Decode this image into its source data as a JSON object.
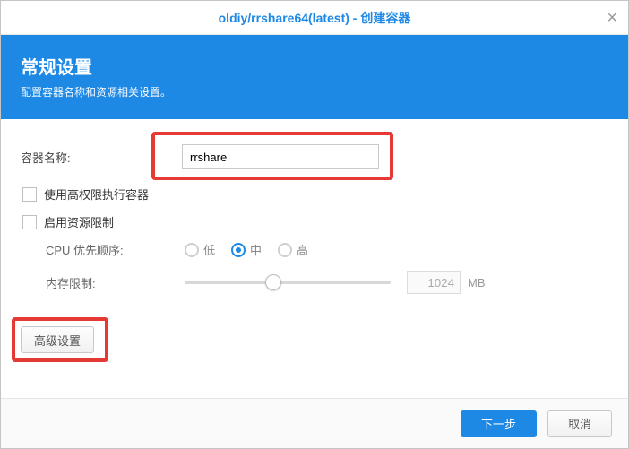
{
  "title": "oldiy/rrshare64(latest) - 创建容器",
  "banner": {
    "title": "常规设置",
    "subtitle": "配置容器名称和资源相关设置。"
  },
  "form": {
    "name_label": "容器名称:",
    "name_value": "rrshare",
    "chk_priv": "使用高权限执行容器",
    "chk_limit": "启用资源限制",
    "cpu_label": "CPU 优先顺序:",
    "cpu_opts": {
      "low": "低",
      "mid": "中",
      "high": "高"
    },
    "mem_label": "内存限制:",
    "mem_value": "1024",
    "mem_unit": "MB",
    "adv_btn": "高级设置"
  },
  "footer": {
    "next": "下一步",
    "cancel": "取消"
  }
}
